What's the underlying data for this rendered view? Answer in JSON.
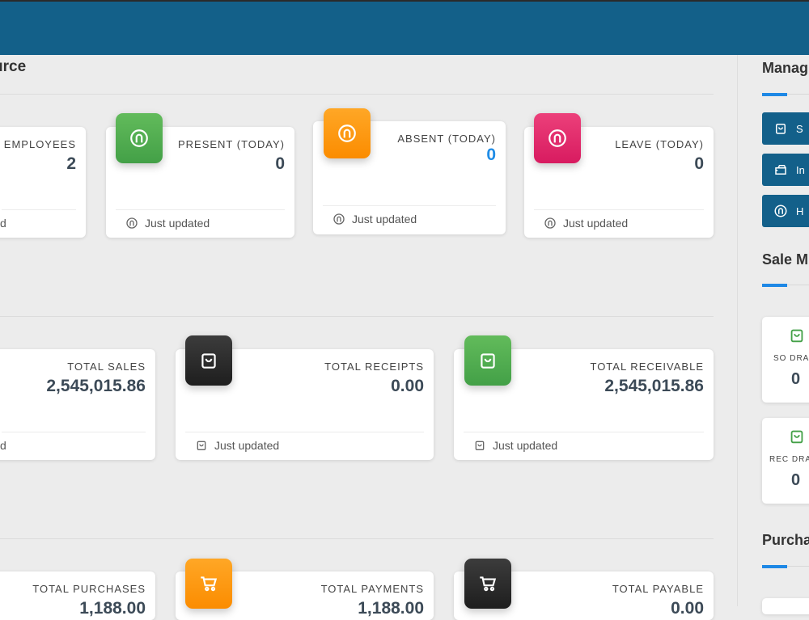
{
  "header": {
    "section_title": "urce"
  },
  "hr_cards": [
    {
      "label": "EMPLOYEES",
      "value": "2",
      "footer": "d",
      "icon": "user-circle-icon",
      "color": "#43a047"
    },
    {
      "label": "PRESENT (TODAY)",
      "value": "0",
      "footer": "Just updated",
      "icon": "user-circle-icon",
      "color": "#43a047"
    },
    {
      "label": "ABSENT (TODAY)",
      "value": "0",
      "footer": "Just updated",
      "icon": "user-circle-icon",
      "color": "#fb8c00",
      "value_color": "#1f8ce6"
    },
    {
      "label": "LEAVE (TODAY)",
      "value": "0",
      "footer": "Just updated",
      "icon": "user-circle-icon",
      "color": "#d81b60"
    }
  ],
  "sales_cards": [
    {
      "label": "TOTAL SALES",
      "value": "2,545,015.86",
      "footer": "d"
    },
    {
      "label": "TOTAL RECEIPTS",
      "value": "0.00",
      "footer": "Just updated",
      "icon": "shopping-bag-icon",
      "color": "#1e1e1e"
    },
    {
      "label": "TOTAL RECEIVABLE",
      "value": "2,545,015.86",
      "footer": "Just updated",
      "icon": "shopping-bag-icon",
      "color": "#43a047"
    }
  ],
  "purchase_cards": [
    {
      "label": "TOTAL PURCHASES",
      "value": "1,188.00"
    },
    {
      "label": "TOTAL PAYMENTS",
      "value": "1,188.00",
      "icon": "cart-icon",
      "color": "#fb8c00"
    },
    {
      "label": "TOTAL PAYABLE",
      "value": "0.00",
      "icon": "cart-icon",
      "color": "#1e1e1e"
    }
  ],
  "sidebar": {
    "manage_title": "Manag",
    "buttons": [
      {
        "label": "S",
        "icon": "shopping-bag-icon"
      },
      {
        "label": "In",
        "icon": "inventory-icon"
      },
      {
        "label": "H",
        "icon": "user-circle-icon"
      }
    ],
    "sale_title": "Sale M",
    "mini_cards": [
      {
        "label": "SO DRA",
        "value": "0",
        "icon": "shopping-bag-icon"
      },
      {
        "label": "REC DRA",
        "value": "0",
        "icon": "shopping-bag-icon"
      }
    ],
    "purchase_title": "Purcha"
  }
}
